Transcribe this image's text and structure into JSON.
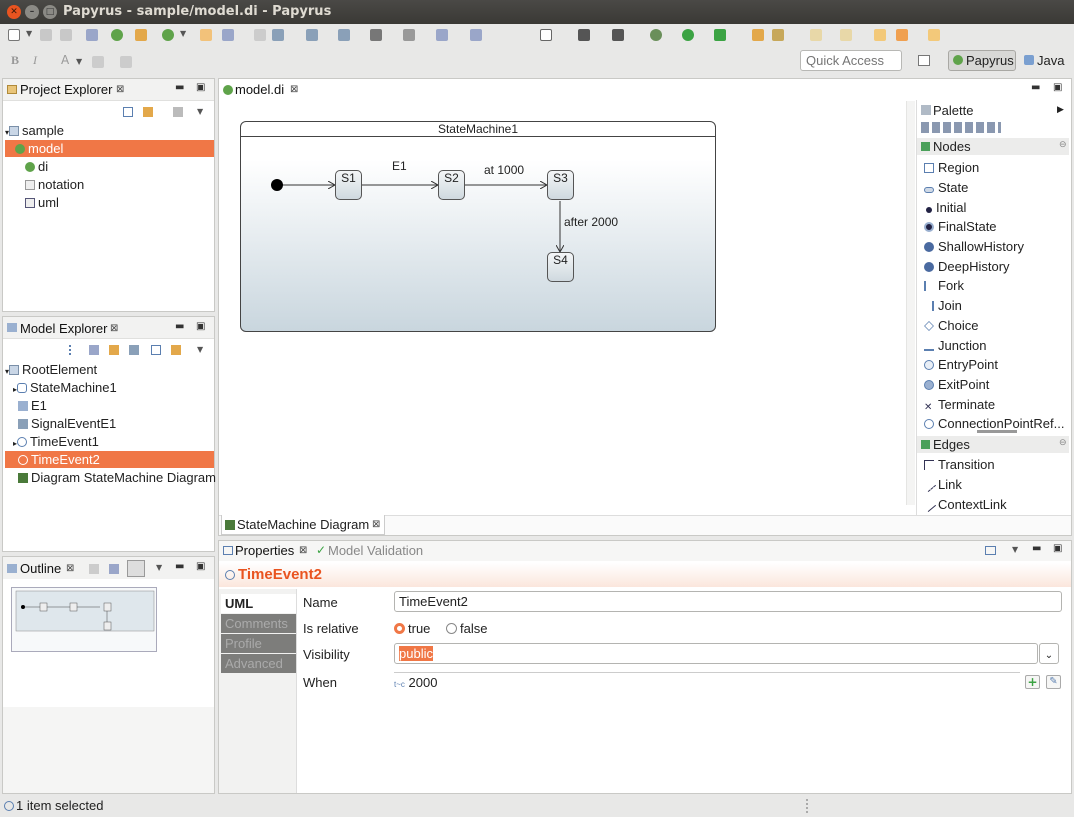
{
  "window": {
    "title": "Papyrus - sample/model.di - Papyrus"
  },
  "toolbar": {
    "quick_access_placeholder": "Quick Access",
    "bold": "B",
    "italic": "I",
    "font": "A"
  },
  "perspectives": {
    "papyrus": "Papyrus",
    "java": "Java"
  },
  "project_explorer": {
    "title": "Project Explorer",
    "items": [
      {
        "label": "sample"
      },
      {
        "label": "model"
      },
      {
        "label": "di"
      },
      {
        "label": "notation"
      },
      {
        "label": "uml"
      }
    ]
  },
  "model_explorer": {
    "title": "Model Explorer",
    "items": [
      {
        "label": "RootElement"
      },
      {
        "label": "StateMachine1"
      },
      {
        "label": "E1"
      },
      {
        "label": "SignalEventE1"
      },
      {
        "label": "TimeEvent1"
      },
      {
        "label": "TimeEvent2"
      },
      {
        "label": "Diagram StateMachine Diagram"
      }
    ]
  },
  "outline": {
    "title": "Outline"
  },
  "editor": {
    "tab": "model.di",
    "bottom_tab": "StateMachine Diagram",
    "state_machine": "StateMachine1",
    "states": [
      "S1",
      "S2",
      "S3",
      "S4"
    ],
    "transitions": [
      "E1",
      "at 1000",
      "after 2000"
    ]
  },
  "palette": {
    "title": "Palette",
    "nodes_title": "Nodes",
    "nodes": [
      "Region",
      "State",
      "Initial",
      "FinalState",
      "ShallowHistory",
      "DeepHistory",
      "Fork",
      "Join",
      "Choice",
      "Junction",
      "EntryPoint",
      "ExitPoint",
      "Terminate",
      "ConnectionPointRef..."
    ],
    "edges_title": "Edges",
    "edges": [
      "Transition",
      "Link",
      "ContextLink"
    ]
  },
  "properties": {
    "tab": "Properties",
    "validation_tab": "Model Validation",
    "element": "TimeEvent2",
    "side_tabs": [
      "UML",
      "Comments",
      "Profile",
      "Advanced"
    ],
    "fields": {
      "name_label": "Name",
      "name_value": "TimeEvent2",
      "relative_label": "Is relative",
      "relative_true": "true",
      "relative_false": "false",
      "visibility_label": "Visibility",
      "visibility_value": "public",
      "when_label": "When",
      "when_prefix": "t~c",
      "when_value": "2000"
    }
  },
  "status": {
    "text": "1 item selected"
  },
  "colors": {
    "accent": "#f07746",
    "title_bar": "#3c3b37",
    "selection": "#f07746"
  }
}
